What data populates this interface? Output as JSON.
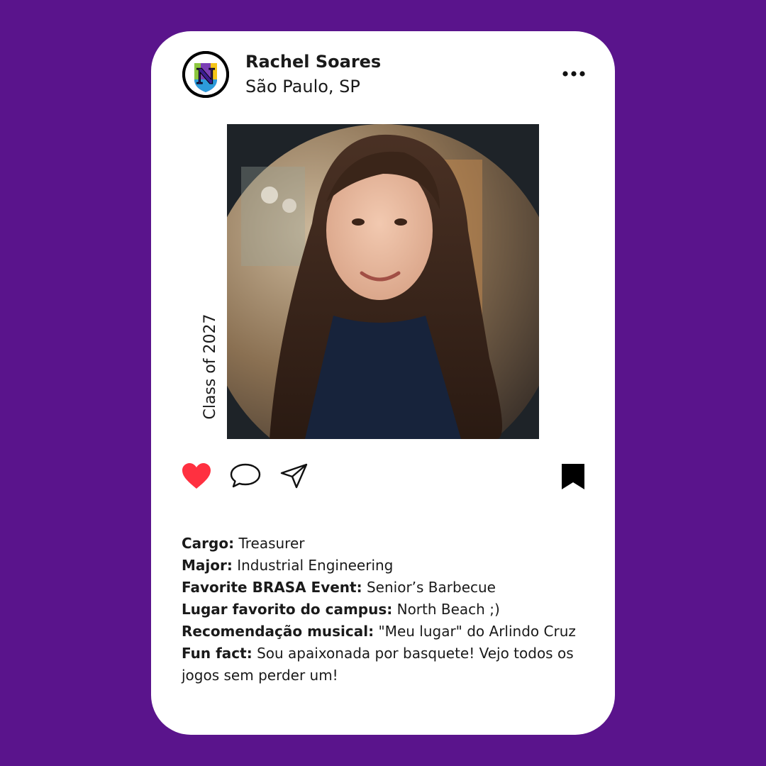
{
  "profile": {
    "name": "Rachel Soares",
    "location": "São Paulo, SP",
    "logo_letter": "N",
    "class_label": "Class of 2027"
  },
  "icons": {
    "more": "more-options-icon",
    "like": "heart-icon",
    "comment": "comment-icon",
    "share": "send-icon",
    "save": "bookmark-icon"
  },
  "colors": {
    "background": "#5a148c",
    "card": "#ffffff",
    "heart": "#ff3040"
  },
  "details": [
    {
      "label": "Cargo:",
      "value": "Treasurer"
    },
    {
      "label": "Major:",
      "value": "Industrial Engineering"
    },
    {
      "label": "Favorite BRASA Event:",
      "value": "Senior’s Barbecue"
    },
    {
      "label": "Lugar favorito do campus:",
      "value": "North Beach ;)"
    },
    {
      "label": "Recomendação musical:",
      "value": "\"Meu lugar\" do Arlindo Cruz"
    },
    {
      "label": "Fun fact:",
      "value": "Sou apaixonada por basquete! Vejo todos os jogos sem perder um!"
    }
  ]
}
